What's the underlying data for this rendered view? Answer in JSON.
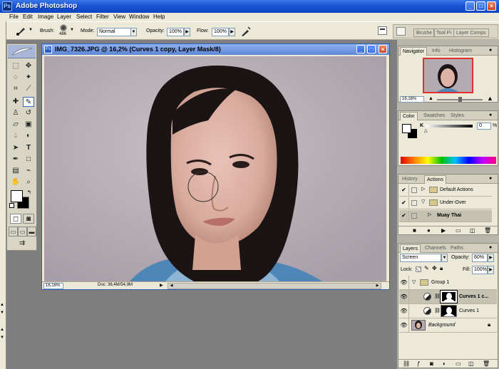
{
  "app": {
    "title": "Adobe Photoshop",
    "icon": "photoshop-icon"
  },
  "menu": [
    "File",
    "Edit",
    "Image",
    "Layer",
    "Select",
    "Filter",
    "View",
    "Window",
    "Help"
  ],
  "options_bar": {
    "brush_label": "Brush:",
    "brush_size": "486",
    "mode_label": "Mode:",
    "mode_value": "Normal",
    "opacity_label": "Opacity:",
    "opacity_value": "100%",
    "flow_label": "Flow:",
    "flow_value": "100%",
    "well_tabs": [
      "Brushe",
      "Tool Pi",
      "Layer Comps"
    ]
  },
  "document": {
    "title": "IMG_7326.JPG @ 16,2% (Curves 1 copy, Layer Mask/8)",
    "zoom": "16,16%",
    "doc_info": "Doc: 36,4M/54,9M"
  },
  "navigator": {
    "tabs": [
      "Navigator",
      "Info",
      "Histogram"
    ],
    "zoom": "16.16%",
    "zoom_fraction": 0.5
  },
  "color": {
    "tabs": [
      "Color",
      "Swatches",
      "Styles"
    ],
    "channel": "K",
    "value": "0",
    "unit": "%"
  },
  "actions": {
    "tabs": [
      "History",
      "Actions"
    ],
    "items": [
      {
        "label": "Default Actions",
        "checked": true
      },
      {
        "label": "Under-Over",
        "checked": true
      },
      {
        "label": "Muay Thai",
        "checked": true
      }
    ]
  },
  "layers": {
    "tabs": [
      "Layers",
      "Channels",
      "Paths"
    ],
    "blend_mode": "Screen",
    "opacity_label": "Opacity:",
    "opacity_value": "60%",
    "lock_label": "Lock:",
    "fill_label": "Fill:",
    "fill_value": "100%",
    "items": [
      {
        "name": "Group 1",
        "kind": "group"
      },
      {
        "name": "Curves 1 c...",
        "kind": "adjustment",
        "selected": true
      },
      {
        "name": "Curves 1",
        "kind": "adjustment"
      },
      {
        "name": "Background",
        "kind": "image",
        "locked": true
      }
    ]
  },
  "colors": {
    "title_bar": "#1854d2",
    "panel_bg": "#ece9d8",
    "workspace": "#7f7f7f",
    "accent": "#316ac5"
  }
}
